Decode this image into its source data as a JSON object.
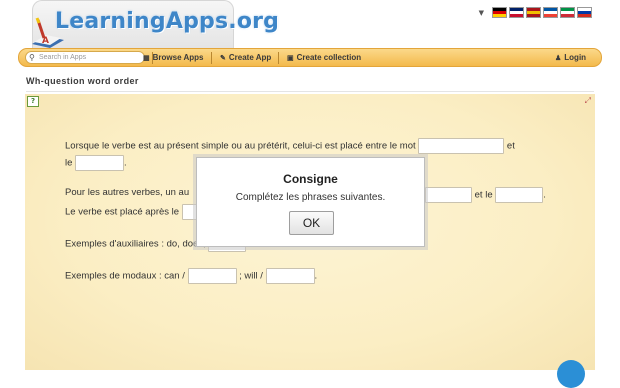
{
  "header": {
    "logo_text": "LearningApps.org",
    "languages": [
      {
        "name": "de-flag-icon",
        "colors": [
          "#000000",
          "#dd0000",
          "#ffce00"
        ]
      },
      {
        "name": "gb-flag-icon",
        "colors": [
          "#012169",
          "#ffffff",
          "#c8102e"
        ]
      },
      {
        "name": "es-flag-icon",
        "colors": [
          "#aa151b",
          "#f1bf00",
          "#aa151b"
        ]
      },
      {
        "name": "fr-flag-icon",
        "colors": [
          "#0055a4",
          "#ffffff",
          "#ef4135"
        ]
      },
      {
        "name": "it-flag-icon",
        "colors": [
          "#009246",
          "#ffffff",
          "#ce2b37"
        ]
      },
      {
        "name": "ru-flag-icon",
        "colors": [
          "#ffffff",
          "#0039a6",
          "#d52b1e"
        ]
      }
    ]
  },
  "nav": {
    "search_placeholder": "Search in Apps",
    "browse": "Browse Apps",
    "create": "Create App",
    "collection": "Create collection",
    "login": "Login"
  },
  "page": {
    "title": "Wh-question word order"
  },
  "exercise": {
    "l1a": "Lorsque le verbe est au présent simple ou au prétérit, celui-ci est placé entre le mot",
    "l1b": "et",
    "l2a": "le",
    "l2b": ".",
    "l3a": "Pour les autres verbes, un au",
    "l3b": "et le",
    "l3c": ".",
    "l4a": "Le verbe est placé après le",
    "l5a": "Exemples d'auxiliaires : do, does,",
    "l6a": "Exemples de modaux : can /",
    "l6b": "; will /",
    "l6c": "."
  },
  "modal": {
    "title": "Consigne",
    "text": "Complétez les phrases suivantes.",
    "ok": "OK"
  },
  "colors": {
    "accent": "#f3b94c",
    "logo": "#3e86c8",
    "fab": "#2b8fd6"
  }
}
